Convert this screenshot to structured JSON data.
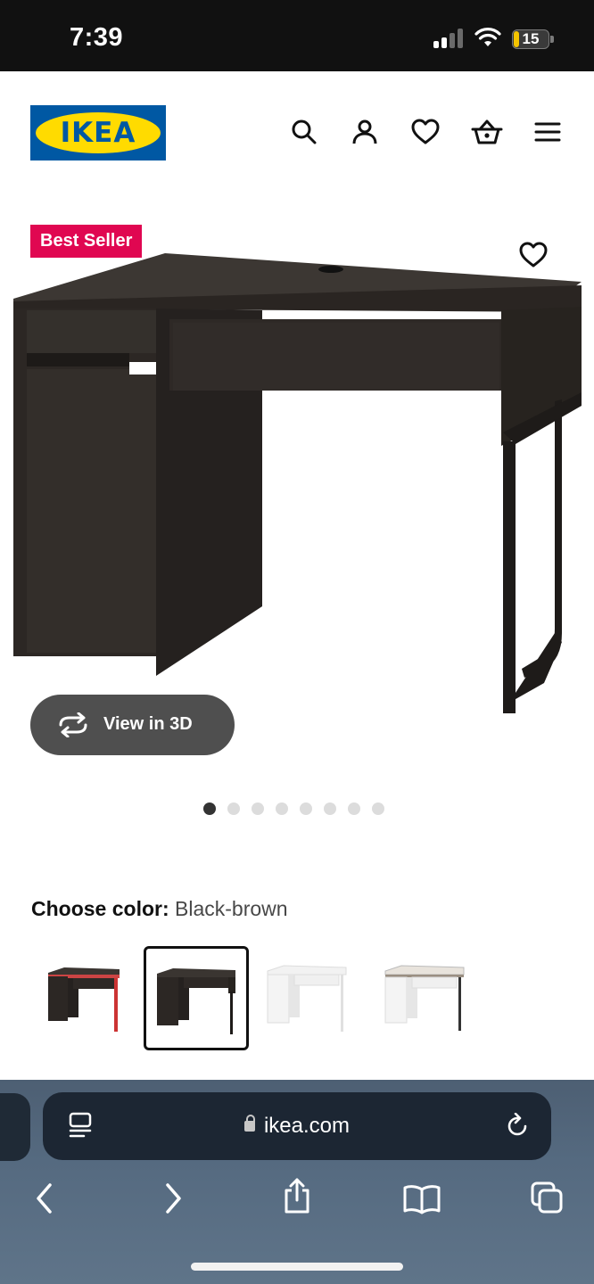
{
  "status_bar": {
    "time": "7:39",
    "battery_level": "15",
    "icons": [
      "cellular-signal-icon",
      "wifi-icon",
      "battery-icon"
    ]
  },
  "header": {
    "logo_text": "IKEA",
    "icons": [
      "search-icon",
      "account-icon",
      "heart-icon",
      "basket-icon",
      "menu-icon"
    ]
  },
  "product": {
    "badge": "Best Seller",
    "view_3d_label": "View in 3D",
    "image_count": 8,
    "active_image": 1,
    "favorite_icon": "heart-icon"
  },
  "color_chooser": {
    "label": "Choose color:",
    "selected_value": "Black-brown",
    "swatches": [
      {
        "name": "black-brown-red",
        "selected": false
      },
      {
        "name": "black-brown",
        "selected": true
      },
      {
        "name": "white",
        "selected": false
      },
      {
        "name": "white-anthracite",
        "selected": false
      }
    ]
  },
  "browser": {
    "url": "ikea.com",
    "icons": [
      "reader-icon",
      "reload-icon",
      "back-icon",
      "forward-icon",
      "share-icon",
      "bookmarks-icon",
      "tabs-icon"
    ]
  },
  "colors": {
    "ikea_blue": "#0058a3",
    "ikea_yellow": "#ffdb00",
    "badge_red": "#e00751",
    "desk_color": "#2f2a26"
  }
}
